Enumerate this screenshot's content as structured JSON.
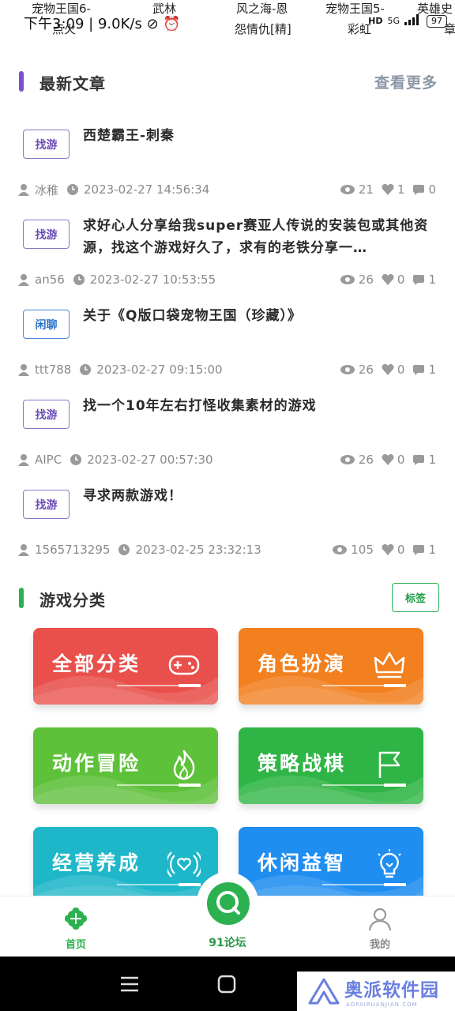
{
  "status_bar": {
    "tickers": [
      "宠物王国6-",
      "武林",
      "风之海-恩",
      "宠物王国5-",
      "英雄史"
    ],
    "tickers_line2": [
      "点火",
      "怨情仇[精]",
      "彩虹",
      "章"
    ],
    "time": "下午3:09",
    "speed": "9.0K/s",
    "network_badge": "HD",
    "signal": "5G",
    "battery": "97"
  },
  "latest": {
    "title": "最新文章",
    "more": "查看更多",
    "accent": "#7b4fd1"
  },
  "articles": [
    {
      "tag": "找游",
      "title": "西楚霸王-刺秦",
      "author": "冰稚",
      "time": "2023-02-27  14:56:34",
      "views": "21",
      "likes": "1",
      "comments": "0"
    },
    {
      "tag": "找游",
      "title": "求好心人分享给我super赛亚人传说的安装包或其他资源，找这个游戏好久了，求有的老铁分享一…",
      "author": "an56",
      "time": "2023-02-27  10:53:55",
      "views": "26",
      "likes": "0",
      "comments": "1"
    },
    {
      "tag": "闲聊",
      "title": "关于《Q版口袋宠物王国（珍藏）》",
      "author": "ttt788",
      "time": "2023-02-27  09:15:00",
      "views": "26",
      "likes": "0",
      "comments": "1"
    },
    {
      "tag": "找游",
      "title": "找一个10年左右打怪收集素材的游戏",
      "author": "AIPC",
      "time": "2023-02-27  00:57:30",
      "views": "26",
      "likes": "0",
      "comments": "1"
    },
    {
      "tag": "找游",
      "title": "寻求两款游戏！",
      "author": "1565713295",
      "time": "2023-02-25  23:32:13",
      "views": "105",
      "likes": "0",
      "comments": "1"
    }
  ],
  "categories": {
    "title": "游戏分类",
    "tag_button": "标签",
    "accent": "#2db04f",
    "items": [
      {
        "label": "全部分类",
        "icon": "gamepad-icon",
        "color": "#e9504c"
      },
      {
        "label": "角色扮演",
        "icon": "crown-icon",
        "color": "#f2801f"
      },
      {
        "label": "动作冒险",
        "icon": "flame-icon",
        "color": "#5ec13a"
      },
      {
        "label": "策略战棋",
        "icon": "flag-icon",
        "color": "#2fb545"
      },
      {
        "label": "经营养成",
        "icon": "heart-signal-icon",
        "color": "#1eb7c9"
      },
      {
        "label": "休闲益智",
        "icon": "bulb-icon",
        "color": "#1f8ef0"
      }
    ]
  },
  "bottom_nav": {
    "home": "首页",
    "forum": "91论坛",
    "mine": "我的"
  },
  "watermark": {
    "text": "奥派软件园",
    "sub": "AOPAIRUANJIAN.COM"
  }
}
